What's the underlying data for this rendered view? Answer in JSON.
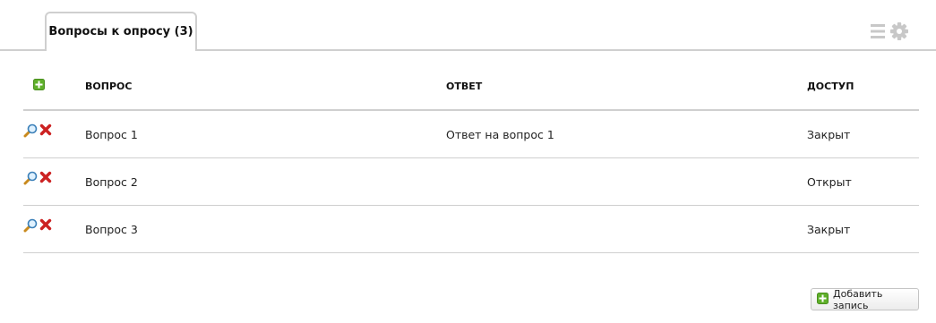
{
  "tabs": [
    {
      "label": "Вопросы к опросу (3)"
    }
  ],
  "toolbar": {
    "list_icon": "list-icon",
    "settings_icon": "gear-icon"
  },
  "table": {
    "columns": {
      "question": "ВОПРОС",
      "answer": "ОТВЕТ",
      "access": "ДОСТУП"
    },
    "rows": [
      {
        "question": "Вопрос 1",
        "answer": "Ответ на вопрос 1",
        "access": "Закрыт"
      },
      {
        "question": "Вопрос 2",
        "answer": "",
        "access": "Открыт"
      },
      {
        "question": "Вопрос 3",
        "answer": "",
        "access": "Закрыт"
      }
    ]
  },
  "add_button": {
    "label": "Добавить запись"
  },
  "colors": {
    "add_green": "#5fb02a",
    "delete_red": "#cc2222",
    "border": "#cfcfcf"
  }
}
